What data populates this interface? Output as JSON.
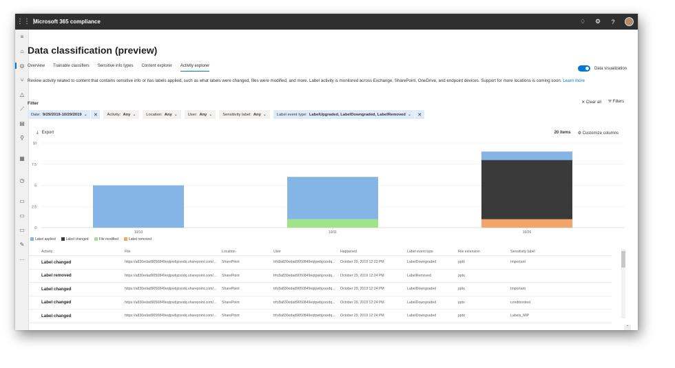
{
  "app": {
    "title": "Microsoft 365 compliance"
  },
  "page": {
    "title": "Data classification (preview)",
    "tabs": [
      "Overview",
      "Trainable classifiers",
      "Sensitive info types",
      "Content explorer",
      "Activity explorer"
    ],
    "active_tab": "Activity explorer",
    "toggle_label": "Data visualization",
    "description": "Review activity related to content that contains sensitive info or has labels applied, such as what labels were changed, files were modified, and more. Label activity is monitored across Exchange, SharePoint, OneDrive, and endpoint devices. Support for more locations is coming soon.",
    "learn_more": "Learn more"
  },
  "filter": {
    "label": "Filter",
    "clear_all": "Clear all",
    "filters": "Filters",
    "chips": [
      {
        "name": "Date:",
        "value": "9/29/2019-10/29/2019"
      },
      {
        "name": "Activity:",
        "value": "Any"
      },
      {
        "name": "Location:",
        "value": "Any"
      },
      {
        "name": "User:",
        "value": "Any"
      },
      {
        "name": "Sensitivity label:",
        "value": "Any"
      },
      {
        "name": "Label event type:",
        "value": "LabelUpgraded, LabelDowngraded, LabelRemoved"
      }
    ]
  },
  "toolbar": {
    "export": "Export",
    "count": "20 items",
    "customize": "Customize columns"
  },
  "chart_data": {
    "type": "bar",
    "stacked": true,
    "categories": [
      "10/10",
      "10/11",
      "10/26"
    ],
    "yticks": [
      "0",
      "2.5",
      "5",
      "7.5",
      "10"
    ],
    "ylim": [
      0,
      10
    ],
    "series": [
      {
        "name": "Label applied",
        "color": "#85b4e6",
        "values": [
          5,
          5,
          1
        ]
      },
      {
        "name": "Label changed",
        "color": "#3a3a3a",
        "values": [
          0,
          0,
          7
        ]
      },
      {
        "name": "File modified",
        "color": "#a0e389",
        "values": [
          0,
          1,
          0
        ]
      },
      {
        "name": "Label removed",
        "color": "#f2a46a",
        "values": [
          0,
          0,
          1
        ]
      }
    ],
    "stack_order": [
      "Label removed",
      "File modified",
      "Label changed",
      "Label applied"
    ]
  },
  "table": {
    "headers": [
      "Activity",
      "File",
      "Location",
      "User",
      "Happened",
      "Label event type",
      "File extension",
      "Sensitivity label"
    ],
    "rows": [
      [
        "Label changed",
        "https://a830edad9050849eqtpwbjzsodq.sharepoint.com/...",
        "SharePoint",
        "trfc8a830edad9050849eqtpwbjzsodq...",
        "October 29, 2019 12:23 PM",
        "LabelDowngraded",
        "pptx",
        "Important"
      ],
      [
        "Label removed",
        "https://a830edad9050849eqtpwbjzsodq.sharepoint.com/...",
        "SharePoint",
        "trfc8a830edad9050849eqtpwbjzsodq...",
        "October 29, 2019 12:24 PM",
        "LabelRemoved",
        "pptx",
        ""
      ],
      [
        "Label changed",
        "https://a830edad9050849eqtpwbjzsodq.sharepoint.com/...",
        "SharePoint",
        "trfc8a830edad9050849eqtpwbjzsodq...",
        "October 29, 2019 12:24 PM",
        "LabelDowngraded",
        "pptx",
        "Important"
      ],
      [
        "Label changed",
        "https://a830edad9050849eqtpwbjzsodq.sharepoint.com/...",
        "SharePoint",
        "trfc8a830edad9050849eqtpwbjzsodq...",
        "October 29, 2019 12:24 PM",
        "LabelDowngraded",
        "pptx",
        "conditiontest"
      ],
      [
        "Label changed",
        "https://a830edad9050849eqtpwbjzsodq.sharepoint.com/...",
        "SharePoint",
        "trfc8a830edad9050849eqtpwbjzsodq...",
        "October 29, 2019 12:24 PM",
        "LabelDowngraded",
        "pptx",
        "Labels_MIP"
      ]
    ]
  },
  "colors": {
    "accent": "#0078d4",
    "topbar": "#2f2f2f"
  },
  "icons": {
    "waffle": "waffle-icon",
    "bell": "bell-icon",
    "gear": "gear-icon",
    "help": "help-icon",
    "export": "download-icon",
    "clear": "close-icon",
    "filter": "filter-icon",
    "customize": "settings-icon"
  }
}
